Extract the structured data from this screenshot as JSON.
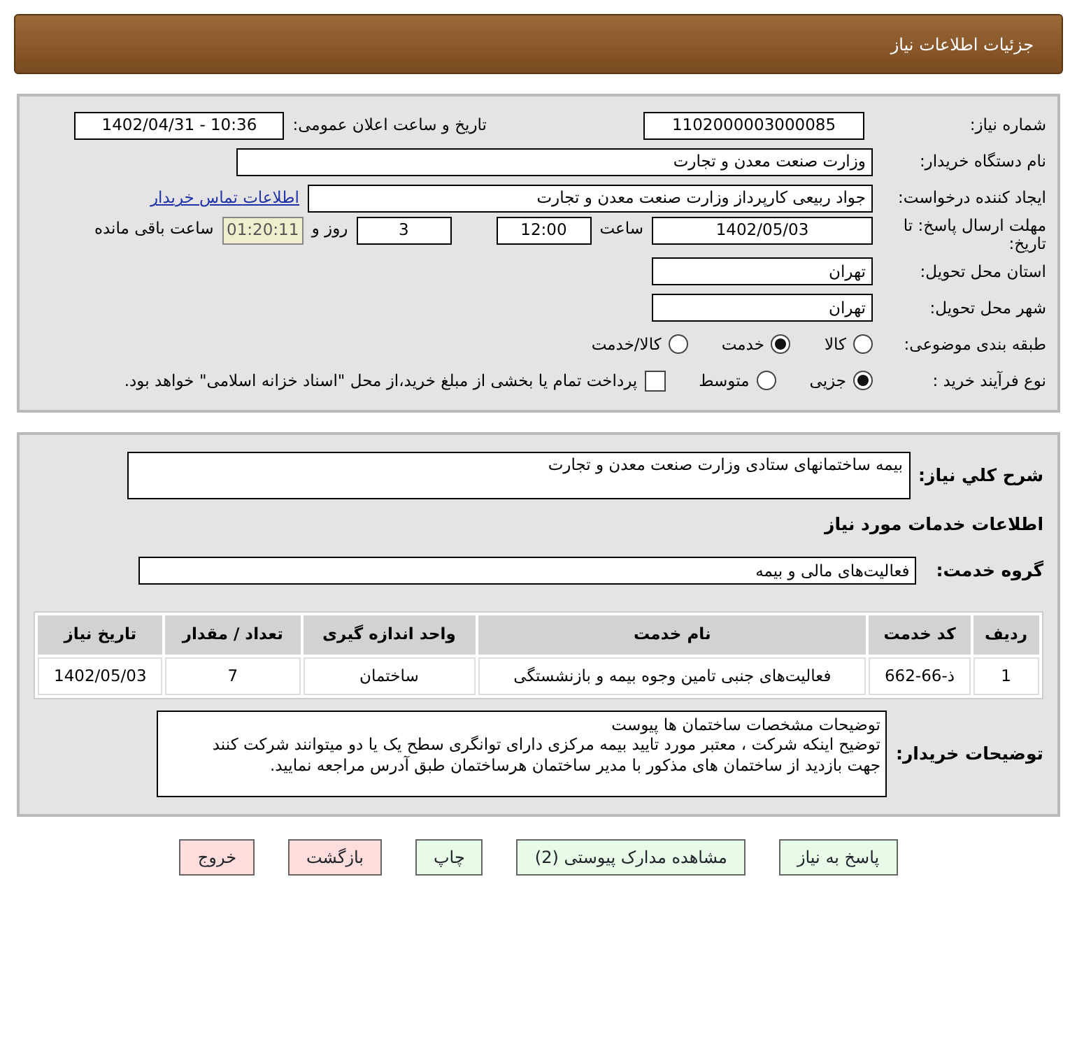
{
  "header": {
    "title": "جزئیات اطلاعات نیاز"
  },
  "need_number": {
    "label": "شماره نیاز:",
    "value": "1102000003000085"
  },
  "announce": {
    "label": "تاریخ و ساعت اعلان عمومی:",
    "value": "1402/04/31 - 10:36"
  },
  "buyer_org": {
    "label": "نام دستگاه خریدار:",
    "value": "وزارت صنعت معدن و تجارت"
  },
  "requester": {
    "label": "ایجاد کننده درخواست:",
    "value": "جواد ربیعی کارپرداز وزارت صنعت معدن و تجارت",
    "link": "اطلاعات تماس خریدار"
  },
  "deadline": {
    "label": "مهلت ارسال پاسخ: تا تاریخ:",
    "date": "1402/05/03",
    "time_label": "ساعت",
    "time": "12:00",
    "days": "3",
    "days_label": "روز و",
    "remaining": "01:20:11",
    "remaining_label": "ساعت باقی مانده"
  },
  "province": {
    "label": "استان محل تحویل:",
    "value": "تهران"
  },
  "city": {
    "label": "شهر محل تحویل:",
    "value": "تهران"
  },
  "category": {
    "label": "طبقه بندی موضوعی:",
    "options": [
      {
        "label": "کالا",
        "selected": false
      },
      {
        "label": "خدمت",
        "selected": true
      },
      {
        "label": "کالا/خدمت",
        "selected": false
      }
    ]
  },
  "process": {
    "label": "نوع فرآیند خرید :",
    "options": [
      {
        "label": "جزیی",
        "selected": true
      },
      {
        "label": "متوسط",
        "selected": false
      }
    ],
    "payment": {
      "label": "پرداخت تمام یا بخشی از مبلغ خرید،از محل \"اسناد خزانه اسلامی\" خواهد بود.",
      "checked": false
    }
  },
  "description": {
    "label": "شرح کلي نياز:",
    "value": "بیمه ساختمانهای ستادی وزارت صنعت معدن و تجارت"
  },
  "services_title": "اطلاعات خدمات مورد نیاز",
  "service_group": {
    "label": "گروه خدمت:",
    "value": "فعالیت‌های مالی و بیمه"
  },
  "table": {
    "columns": [
      "ردیف",
      "کد خدمت",
      "نام خدمت",
      "واحد اندازه گیری",
      "تعداد / مقدار",
      "تاریخ نیاز"
    ],
    "rows": [
      [
        "1",
        "ذ-66-662",
        "فعالیت‌های جنبی تامین وجوه بیمه و بازنشستگی",
        "ساختمان",
        "7",
        "1402/05/03"
      ]
    ]
  },
  "buyer_notes": {
    "label": "توضیحات خریدار:",
    "lines": [
      "توضیحات مشخصات ساختمان ها پیوست",
      "توضیح اینکه شرکت ، معتبر مورد تایید بیمه مرکزی دارای توانگری سطح یک یا دو میتوانند شرکت کنند",
      "جهت بازدید از ساختمان های مذکور با مدیر ساختمان هرساختمان طبق آدرس مراجعه نمایید."
    ]
  },
  "buttons": [
    {
      "label": "پاسخ به نیاز",
      "kind": "green"
    },
    {
      "label": "مشاهده مدارک پیوستی (2)",
      "kind": "green"
    },
    {
      "label": "چاپ",
      "kind": "green"
    },
    {
      "label": "بازگشت",
      "kind": "red"
    },
    {
      "label": "خروج",
      "kind": "red"
    }
  ]
}
